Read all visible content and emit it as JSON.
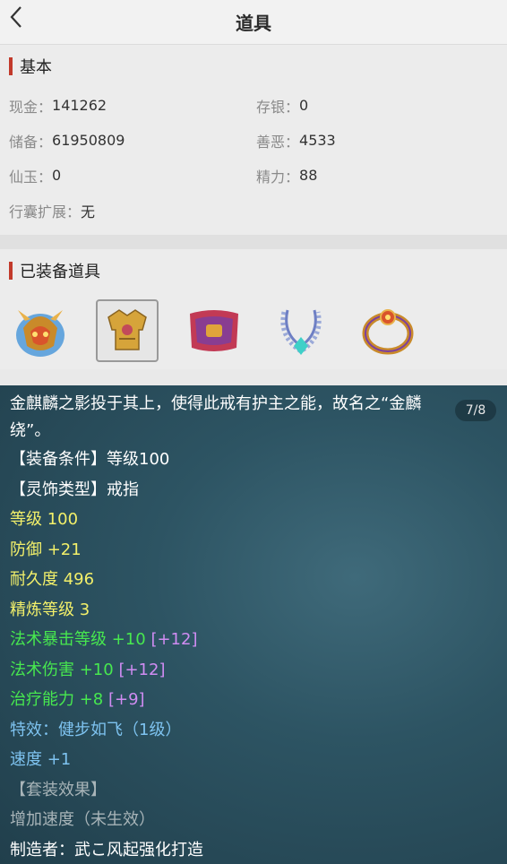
{
  "header": {
    "title": "道具"
  },
  "basic": {
    "title": "基本",
    "stats": [
      {
        "label": "现金：",
        "value": "141262"
      },
      {
        "label": "存银：",
        "value": "0"
      },
      {
        "label": "储备：",
        "value": "61950809"
      },
      {
        "label": "善恶：",
        "value": "4533"
      },
      {
        "label": "仙玉：",
        "value": "0"
      },
      {
        "label": "精力：",
        "value": "88"
      },
      {
        "label": "行囊扩展：",
        "value": "无"
      }
    ]
  },
  "equipped": {
    "title": "已装备道具",
    "items": [
      "helmet-item",
      "armor-item",
      "belt-item",
      "necklace-item",
      "ring-item"
    ],
    "selected_index": 1
  },
  "detail": {
    "page": "7/8",
    "description": "金麒麟之影投于其上，使得此戒有护主之能，故名之“金麟绕”。",
    "lines": {
      "req": "【装备条件】等级100",
      "type": "【灵饰类型】戒指",
      "level": "等级 100",
      "defense": "防御 +21",
      "durability": "耐久度 496",
      "refine": "精炼等级 3",
      "crit_main": "法术暴击等级 +10",
      "crit_bonus": "[+12]",
      "dmg_main": "法术伤害 +10",
      "dmg_bonus": "[+12]",
      "heal_main": "治疗能力 +8",
      "heal_bonus": "[+9]",
      "special": "特效：健步如飞（1级）",
      "speed": "速度 +1",
      "set_title": "【套装效果】",
      "set_effect": "增加速度（未生效）",
      "maker": "制造者：武こ风起强化打造"
    }
  }
}
